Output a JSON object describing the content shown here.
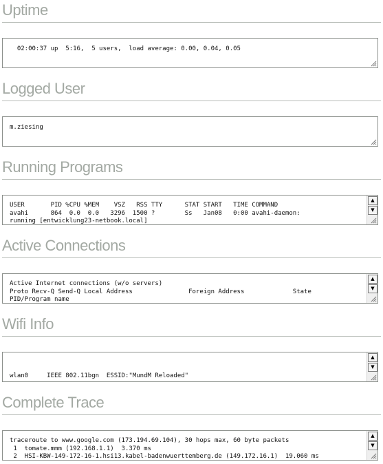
{
  "sections": [
    {
      "title": "Uptime",
      "content": "  02:00:37 up  5:16,  5 users,  load average: 0.00, 0.04, 0.05"
    },
    {
      "title": "Logged User",
      "content": "m.ziesing"
    },
    {
      "title": "Running Programs",
      "content": "USER       PID %CPU %MEM    VSZ   RSS TTY      STAT START   TIME COMMAND\navahi      864  0.0  0.0   3296  1500 ?        Ss   Jan08   0:00 avahi-daemon:\nrunning [entwicklung23-netbook.local]"
    },
    {
      "title": "Active Connections",
      "content": "Active Internet connections (w/o servers)\nProto Recv-Q Send-Q Local Address               Foreign Address             State\nPID/Program name"
    },
    {
      "title": "Wifi Info",
      "content": "\n\n\nwlan0     IEEE 802.11bgn  ESSID:\"MundM Reloaded\""
    },
    {
      "title": "Complete Trace",
      "content": "traceroute to www.google.com (173.194.69.104), 30 hops max, 60 byte packets\n 1  tomate.mmm (192.168.1.1)  3.370 ms\n 2  HSI-KBW-149-172-16-1.hsi13.kabel-badenwuerttemberg.de (149.172.16.1)  19.060 ms"
    }
  ],
  "icons": {
    "scroll_up": "▲",
    "scroll_down": "▼"
  }
}
